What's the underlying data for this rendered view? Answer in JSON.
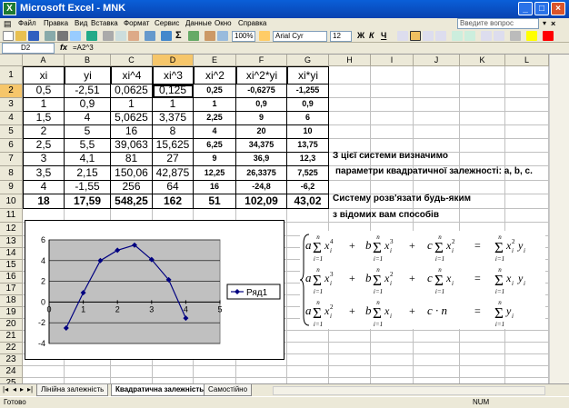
{
  "app": {
    "title": "Microsoft Excel - MNK"
  },
  "menu": [
    "Файл",
    "Правка",
    "Вид",
    "Вставка",
    "Формат",
    "Сервис",
    "Данные",
    "Окно",
    "Справка"
  ],
  "ask_placeholder": "Введите вопрос",
  "toolbar": {
    "zoom": "100%",
    "font": "Arial Cyr",
    "size": "12",
    "bold": "Ж",
    "italic": "К",
    "underline": "Ч",
    "sigma": "Σ"
  },
  "formula_bar": {
    "name_box": "D2",
    "fx": "fx",
    "formula": "=A2^3"
  },
  "columns": [
    "A",
    "B",
    "C",
    "D",
    "E",
    "F",
    "G",
    "H",
    "I",
    "J",
    "K",
    "L"
  ],
  "rows": [
    "1",
    "2",
    "3",
    "4",
    "5",
    "6",
    "7",
    "8",
    "9",
    "10",
    "11",
    "12",
    "13",
    "14",
    "15",
    "16",
    "17",
    "18",
    "19",
    "20",
    "21",
    "22",
    "23",
    "24",
    "25",
    "26"
  ],
  "table": {
    "headers": [
      "xi",
      "yi",
      "xi^4",
      "xi^3",
      "xi^2",
      "xi^2*yi",
      "xi*yi"
    ],
    "data": [
      [
        "0,5",
        "-2,51",
        "0,0625",
        "0,125",
        "0,25",
        "-0,6275",
        "-1,255"
      ],
      [
        "1",
        "0,9",
        "1",
        "1",
        "1",
        "0,9",
        "0,9"
      ],
      [
        "1,5",
        "4",
        "5,0625",
        "3,375",
        "2,25",
        "9",
        "6"
      ],
      [
        "2",
        "5",
        "16",
        "8",
        "4",
        "20",
        "10"
      ],
      [
        "2,5",
        "5,5",
        "39,063",
        "15,625",
        "6,25",
        "34,375",
        "13,75"
      ],
      [
        "3",
        "4,1",
        "81",
        "27",
        "9",
        "36,9",
        "12,3"
      ],
      [
        "3,5",
        "2,15",
        "150,06",
        "42,875",
        "12,25",
        "26,3375",
        "7,525"
      ],
      [
        "4",
        "-1,55",
        "256",
        "64",
        "16",
        "-24,8",
        "-6,2"
      ]
    ],
    "totals": [
      "18",
      "17,59",
      "548,25",
      "162",
      "51",
      "102,09",
      "43,02"
    ]
  },
  "notes": {
    "r7": "З цієї системи визначимо",
    "r8": "параметри квадратичної залежності: a, b, c.",
    "r10": "Систему розв'язати будь-яким",
    "r11": "з відомих вам способів"
  },
  "sheet_tabs": [
    "Лінійна залежність",
    "Квадратична залежність",
    "Самостійно"
  ],
  "status": {
    "left": "Готово",
    "num": "NUM"
  },
  "equations": {
    "sum_top": "n",
    "sum_bottom": "i=1",
    "a": "a",
    "b": "b",
    "c": "c",
    "x": "x",
    "y": "y",
    "i": "i",
    "n": "n",
    "plus": "+",
    "eq": "=",
    "cdot": "c · n",
    "p4": "4",
    "p3": "3",
    "p2": "2"
  },
  "chart_data": {
    "type": "line",
    "x": [
      0.5,
      1,
      1.5,
      2,
      2.5,
      3,
      3.5,
      4
    ],
    "series": [
      {
        "name": "Ряд1",
        "values": [
          -2.51,
          0.9,
          4,
          5,
          5.5,
          4.1,
          2.15,
          -1.55
        ]
      }
    ],
    "xlim": [
      0,
      5
    ],
    "ylim": [
      -4,
      6
    ],
    "xticks": [
      "0",
      "1",
      "2",
      "3",
      "4",
      "5"
    ],
    "yticks": [
      "-4",
      "-2",
      "0",
      "2",
      "4",
      "6"
    ],
    "grid": true,
    "legend": "right",
    "colors": {
      "line": "#000080",
      "plot_bg": "#c0c0c0"
    }
  }
}
